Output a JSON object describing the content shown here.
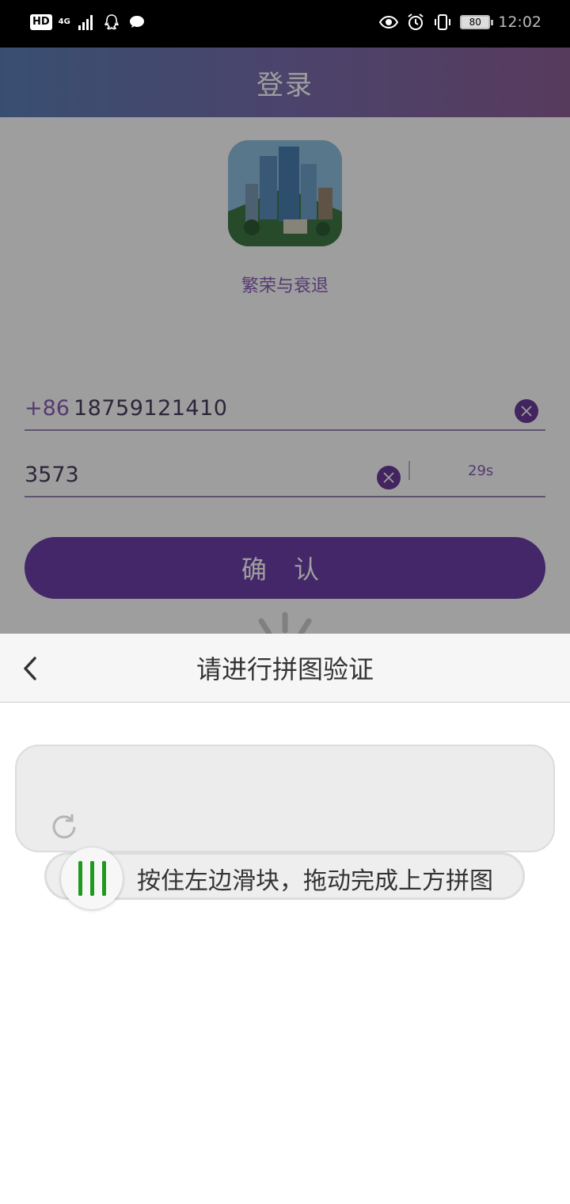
{
  "status_bar": {
    "hd": "HD",
    "network": "4G",
    "battery": "80",
    "time": "12:02",
    "left_icons": [
      "signal-icon",
      "qq-icon",
      "chat-bubble-icon"
    ],
    "right_icons": [
      "eye-icon",
      "alarm-icon",
      "vibrate-icon",
      "battery-icon"
    ]
  },
  "login": {
    "title": "登录",
    "app_name": "繁荣与衰退",
    "phone": {
      "country_code": "+86",
      "value": "18759121410"
    },
    "code": {
      "value": "3573",
      "countdown": "29s"
    },
    "confirm_label": "确 认",
    "colors": {
      "accent": "#6c3fa8",
      "header_start": "#5b7fb6",
      "header_end": "#8d5f97"
    }
  },
  "verify": {
    "title": "请进行拼图验证",
    "slider_hint": "按住左边滑块，拖动完成上方拼图",
    "colors": {
      "grip": "#1f9a1f",
      "track": "#eeeeee"
    }
  }
}
